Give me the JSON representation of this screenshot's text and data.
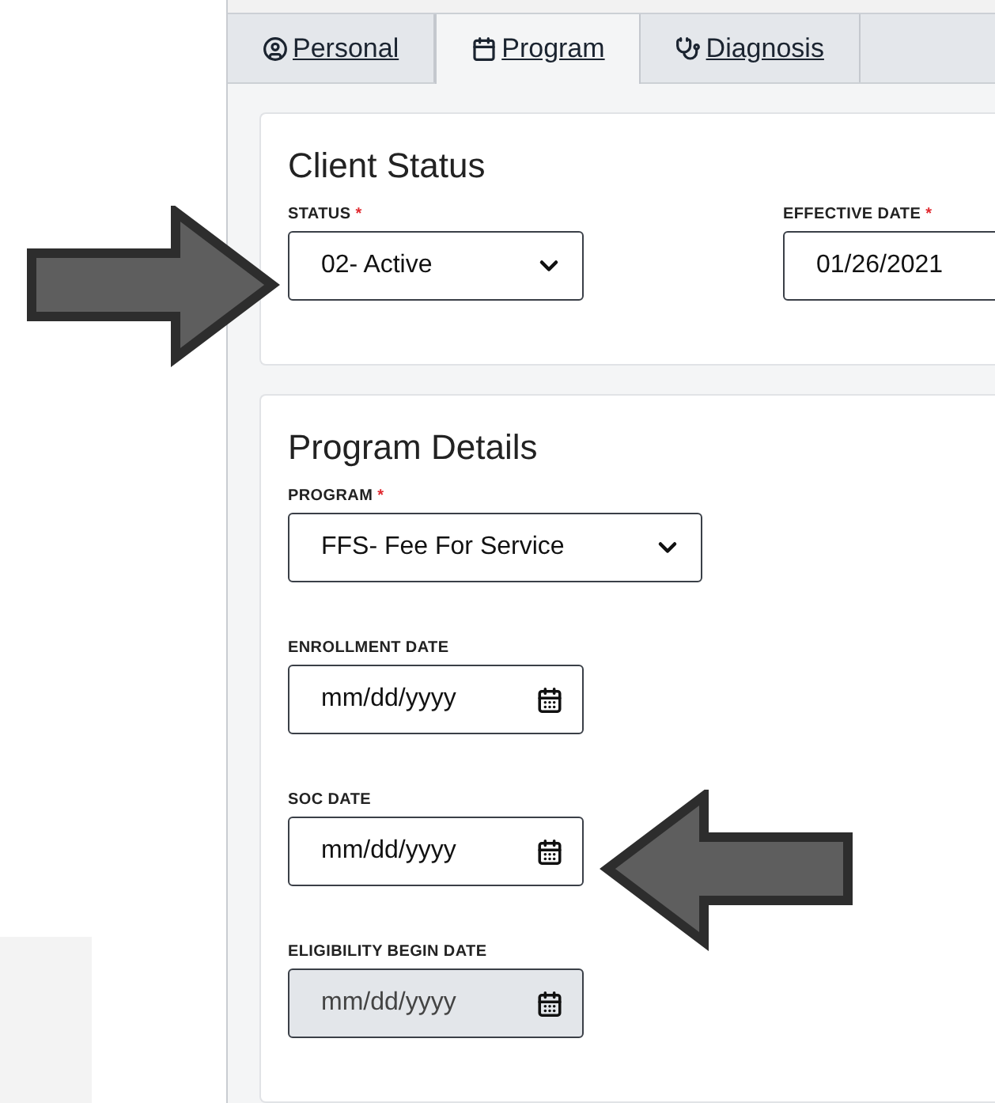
{
  "required_mark": "*",
  "tabs": [
    {
      "label": "Personal",
      "selected": false
    },
    {
      "label": "Program",
      "selected": true
    },
    {
      "label": "Diagnosis",
      "selected": false
    }
  ],
  "cards": [
    {
      "title": "Client Status",
      "fields": [
        {
          "label": "STATUS",
          "required": true,
          "kind": "select",
          "value": "02- Active",
          "disabled": false
        },
        {
          "label": "EFFECTIVE DATE",
          "required": true,
          "kind": "text",
          "value": "01/26/2021",
          "disabled": false
        }
      ]
    },
    {
      "title": "Program Details",
      "fields": [
        {
          "label": "PROGRAM",
          "required": true,
          "kind": "select",
          "value": "FFS- Fee For Service",
          "disabled": false
        },
        {
          "label": "ENROLLMENT DATE",
          "required": false,
          "kind": "date",
          "placeholder": "mm/dd/yyyy",
          "disabled": false
        },
        {
          "label": "SOC DATE",
          "required": false,
          "kind": "date",
          "placeholder": "mm/dd/yyyy",
          "disabled": false
        },
        {
          "label": "ELIGIBILITY BEGIN DATE",
          "required": false,
          "kind": "date",
          "placeholder": "mm/dd/yyyy",
          "disabled": true
        }
      ]
    }
  ]
}
